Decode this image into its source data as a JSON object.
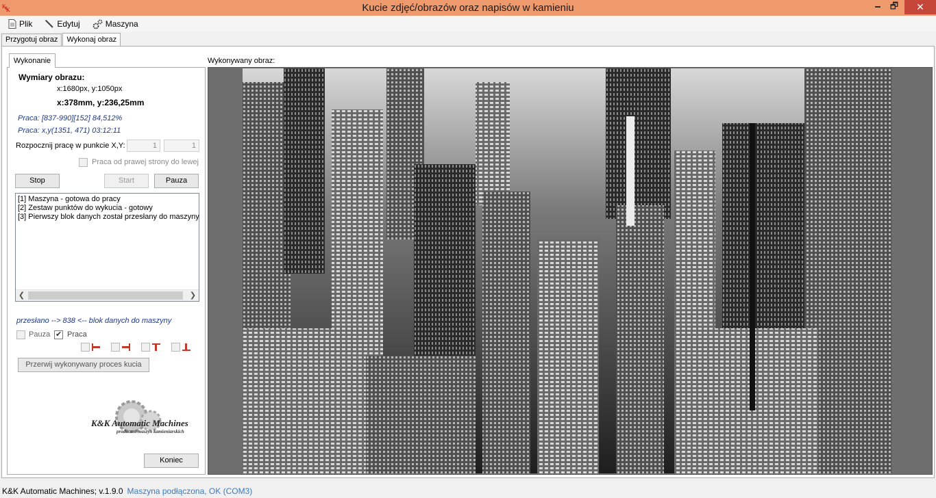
{
  "window": {
    "title": "Kucie zdjęć/obrazów oraz napisów w kamieniu",
    "min_glyph": "🗕",
    "max_glyph": "🗗",
    "close_glyph": "✕"
  },
  "menu": [
    {
      "label": "Plik",
      "icon": "document-icon"
    },
    {
      "label": "Edytuj",
      "icon": "pencil-icon"
    },
    {
      "label": "Maszyna",
      "icon": "gears-icon"
    }
  ],
  "outer_tabs": [
    {
      "label": "Przygotuj obraz",
      "active": false
    },
    {
      "label": "Wykonaj obraz",
      "active": true
    }
  ],
  "inner_tab": "Wykonanie",
  "dimensions": {
    "heading": "Wymiary obrazu:",
    "pixels": "x:1680px, y:1050px",
    "mm": "x:378mm, y:236,25mm"
  },
  "progress": {
    "line1": "Praca: [837-990][152] 84,512%",
    "line2": "Praca: x,y(1351, 471) 03:12:11"
  },
  "start_point": {
    "label": "Rozpocznij pracę w punkcie X,Y:",
    "x": "1",
    "y": "1"
  },
  "right_to_left": {
    "label": "Praca od prawej strony do lewej",
    "checked": false
  },
  "buttons": {
    "stop": "Stop",
    "start": "Start",
    "pause": "Pauza",
    "abort": "Przerwij wykonywany proces kucia",
    "end": "Koniec"
  },
  "log": [
    "[1] Maszyna - gotowa do pracy",
    "[2] Zestaw punktów do wykucia - gotowy",
    "[3] Pierwszy blok danych został przesłany do maszyny"
  ],
  "sent_status": "przesłano --> 838 <-- blok danych do maszyny",
  "state_checks": [
    {
      "label": "Pauza",
      "checked": false
    },
    {
      "label": "Praca",
      "checked": true
    }
  ],
  "logo": {
    "line1": "K&K Automatic Machines",
    "line2": "producent maszyn kamieniarskich"
  },
  "image_label": "Wykonywany obraz:",
  "status": {
    "app": "K&K Automatic Machines; v.1.9.0",
    "connection": "Maszyna podłączona, OK (COM3)"
  },
  "colors": {
    "titlebar": "#ef9a6d",
    "close": "#c7463a",
    "progress_text": "#1e3a8a",
    "connection_text": "#3d7ab8",
    "marker_red": "#c0392b"
  }
}
